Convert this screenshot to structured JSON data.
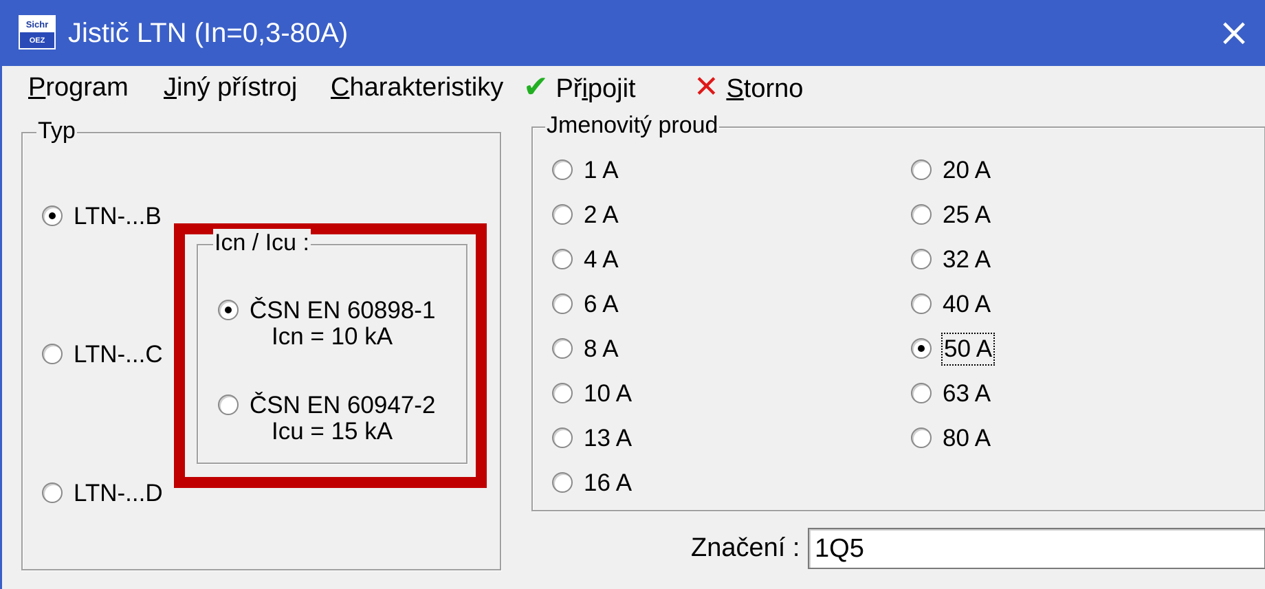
{
  "window": {
    "title": "Jistič LTN (In=0,3-80A)",
    "icon": {
      "name": "sichr-app-icon",
      "top_text": "Sichr",
      "bottom_text": "OEZ"
    },
    "close_icon": "×"
  },
  "menu": {
    "program": {
      "accel": "P",
      "rest": "rogram"
    },
    "jiny": {
      "accel": "J",
      "rest": "iný přístroj"
    },
    "charakteristiky": {
      "accel": "C",
      "rest": "harakteristiky"
    },
    "pripojit": {
      "icon": "✔",
      "pre": "Př",
      "accel": "i",
      "rest": "pojit"
    },
    "storno": {
      "icon": "✕",
      "accel": "S",
      "rest": "torno"
    }
  },
  "typ": {
    "title": "Typ",
    "options": [
      {
        "label": "LTN-...B",
        "checked": true
      },
      {
        "label": "LTN-...C",
        "checked": false
      },
      {
        "label": "LTN-...D",
        "checked": false
      }
    ]
  },
  "icn": {
    "title": "Icn / Icu :",
    "options": [
      {
        "line1": "ČSN EN 60898-1",
        "line2": "Icn = 10 kA",
        "checked": true
      },
      {
        "line1": "ČSN EN 60947-2",
        "line2": "Icu = 15 kA",
        "checked": false
      }
    ]
  },
  "proud": {
    "title": "Jmenovitý proud",
    "left": [
      {
        "label": "1 A",
        "checked": false
      },
      {
        "label": "2 A",
        "checked": false
      },
      {
        "label": "4 A",
        "checked": false
      },
      {
        "label": "6 A",
        "checked": false
      },
      {
        "label": "8 A",
        "checked": false
      },
      {
        "label": "10 A",
        "checked": false
      },
      {
        "label": "13 A",
        "checked": false
      },
      {
        "label": "16 A",
        "checked": false
      }
    ],
    "right": [
      {
        "label": "20 A",
        "checked": false
      },
      {
        "label": "25 A",
        "checked": false
      },
      {
        "label": "32 A",
        "checked": false
      },
      {
        "label": "40 A",
        "checked": false
      },
      {
        "label": "50 A",
        "checked": true
      },
      {
        "label": "63 A",
        "checked": false
      },
      {
        "label": "80 A",
        "checked": false
      }
    ]
  },
  "znaceni": {
    "label": "Značení :",
    "value": "1Q5"
  },
  "colors": {
    "titlebar": "#3a5fc8",
    "highlight": "#c00000",
    "check": "#22b022",
    "cancel": "#e01818"
  }
}
